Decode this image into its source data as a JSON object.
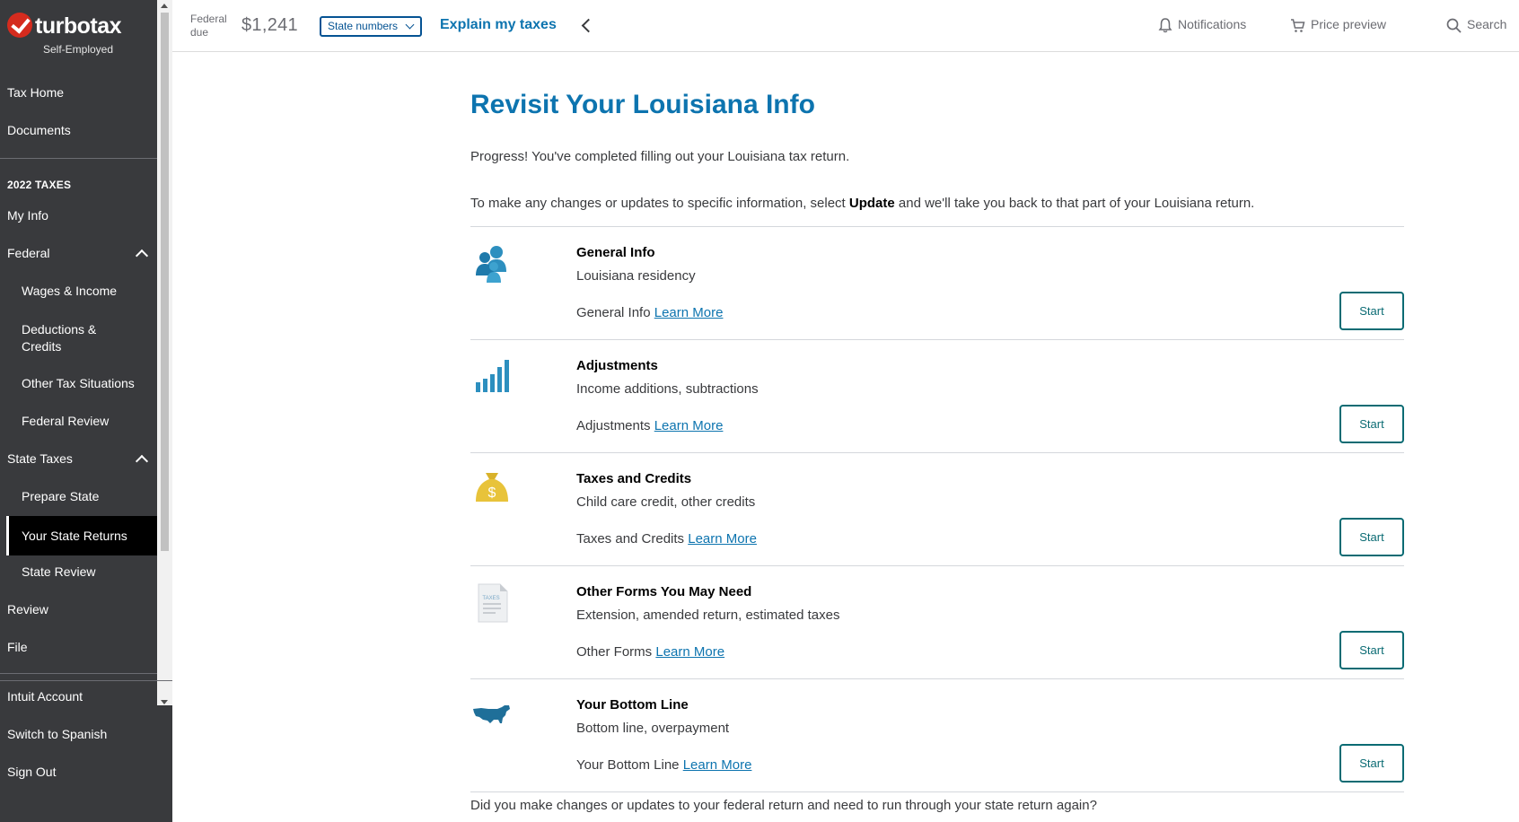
{
  "brand": {
    "name": "turbotax",
    "edition": "Self-Employed"
  },
  "sidebar": {
    "top_items": [
      "Tax Home",
      "Documents"
    ],
    "section_title": "2022 TAXES",
    "items": [
      {
        "label": "My Info"
      },
      {
        "label": "Federal"
      },
      {
        "label": "Wages & Income"
      },
      {
        "label": "Deductions & Credits"
      },
      {
        "label": "Other Tax Situations"
      },
      {
        "label": "Federal Review"
      },
      {
        "label": "State Taxes"
      },
      {
        "label": "Prepare State"
      },
      {
        "label": "Your State Returns"
      },
      {
        "label": "State Review"
      },
      {
        "label": "Review"
      },
      {
        "label": "File"
      }
    ],
    "bottom_items": [
      "Intuit Account",
      "Switch to Spanish",
      "Sign Out"
    ]
  },
  "header": {
    "federal_label": "Federal due",
    "federal_amount": "$1,241",
    "state_numbers": "State numbers",
    "explain": "Explain my taxes",
    "notifications": "Notifications",
    "price_preview": "Price preview",
    "search": "Search"
  },
  "main": {
    "title": "Revisit Your Louisiana Info",
    "progress_text": "Progress! You've completed filling out your Louisiana tax return.",
    "instructions_before": "To make any changes or updates to specific information, select ",
    "instructions_bold": "Update",
    "instructions_after": " and we'll take you back to that part of your Louisiana return.",
    "sections": [
      {
        "title": "General Info",
        "description": "Louisiana residency",
        "link_prefix": "General Info",
        "link_label": "Learn More",
        "button": "Start",
        "icon": "people-icon"
      },
      {
        "title": "Adjustments",
        "description": "Income additions, subtractions",
        "link_prefix": "Adjustments",
        "link_label": "Learn More",
        "button": "Start",
        "icon": "bar-chart-icon"
      },
      {
        "title": "Taxes and Credits",
        "description": "Child care credit, other credits",
        "link_prefix": "Taxes and Credits",
        "link_label": "Learn More",
        "button": "Start",
        "icon": "money-bag-icon"
      },
      {
        "title": "Other Forms You May Need",
        "description": "Extension, amended return, estimated taxes",
        "link_prefix": "Other Forms",
        "link_label": "Learn More",
        "button": "Start",
        "icon": "tax-document-icon"
      },
      {
        "title": "Your Bottom Line",
        "description": "Bottom line, overpayment",
        "link_prefix": "Your Bottom Line",
        "link_label": "Learn More",
        "button": "Start",
        "icon": "us-map-icon"
      }
    ],
    "taxes_doc_label": "TAXES",
    "money_symbol": "$",
    "footer_question": "Did you make changes or updates to your federal return and need to run through your state return again?"
  },
  "colors": {
    "sidebar": "#393a3d",
    "accent": "#0d74af",
    "teal": "#0a6b73",
    "gold": "#e8c33a"
  }
}
